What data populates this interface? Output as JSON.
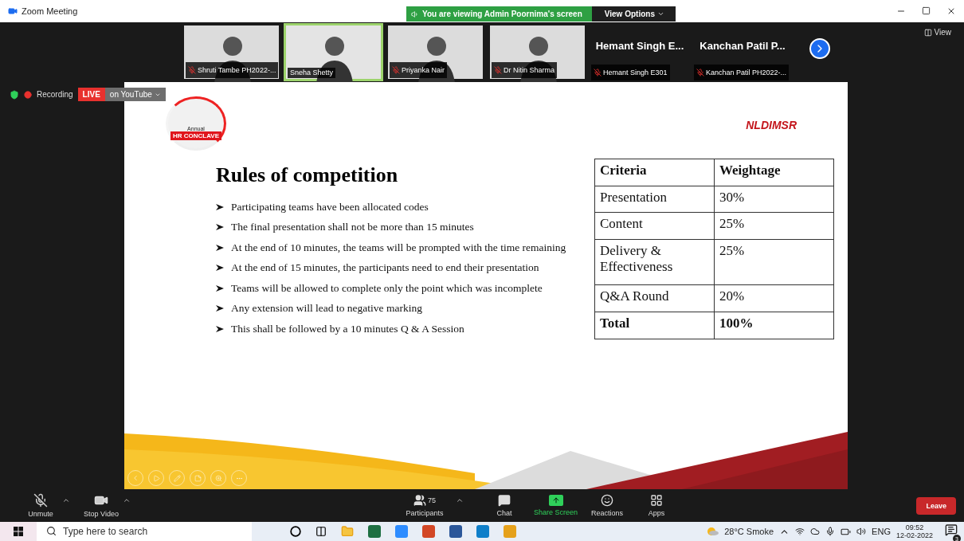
{
  "window": {
    "title": "Zoom Meeting"
  },
  "share_banner": {
    "text": "You are viewing Admin Poornima's screen",
    "options": "View Options"
  },
  "view_button": "View",
  "participants_strip": [
    {
      "kind": "video",
      "name": "Shruti Tambe PH2022-...",
      "muted": true,
      "speaking": false
    },
    {
      "kind": "video",
      "name": "Sneha Shetty",
      "muted": false,
      "speaking": true
    },
    {
      "kind": "video",
      "name": "Priyanka Nair",
      "muted": true,
      "speaking": false
    },
    {
      "kind": "video",
      "name": "Dr Nitin Sharma",
      "muted": true,
      "speaking": false
    },
    {
      "kind": "name",
      "title": "Hemant Singh E...",
      "name": "Hemant Singh E301",
      "muted": true
    },
    {
      "kind": "name",
      "title": "Kanchan Patil P...",
      "name": "Kanchan Patil PH2022-...",
      "muted": true
    }
  ],
  "recording": {
    "label": "Recording",
    "live": "LIVE",
    "stream": "on YouTube"
  },
  "slide": {
    "logo": {
      "line1": "Annual",
      "line2": "HR CONCLAVE"
    },
    "institute": "NLDIMSR",
    "title": "Rules of competition",
    "bullets": [
      "Participating teams have been allocated codes",
      "The final presentation shall not be more than 15 minutes",
      "At the end of 10 minutes, the teams will be prompted with the time remaining",
      "At the end of 15 minutes, the participants need to end their presentation",
      "Teams will be allowed to complete only the point which was incomplete",
      "Any extension will lead to negative marking",
      "This shall be followed by a 10 minutes Q & A Session"
    ],
    "table": {
      "columns": [
        "Criteria",
        "Weightage"
      ],
      "rows": [
        {
          "cells": [
            "Presentation",
            "30%"
          ],
          "bold": false
        },
        {
          "cells": [
            "Content",
            "25%"
          ],
          "bold": false
        },
        {
          "cells": [
            "Delivery & Effectiveness",
            "25%"
          ],
          "bold": false
        },
        {
          "cells": [
            "Q&A Round",
            "20%"
          ],
          "bold": false
        },
        {
          "cells": [
            "Total",
            "100%"
          ],
          "bold": true
        }
      ]
    }
  },
  "toolbar": {
    "left": [
      {
        "kind": "mic",
        "label": "Unmute",
        "muted": true
      },
      {
        "kind": "video",
        "label": "Stop Video",
        "muted": false
      }
    ],
    "center": [
      {
        "kind": "participants",
        "label": "Participants",
        "count": "75",
        "active": false
      },
      {
        "kind": "chat",
        "label": "Chat",
        "active": false
      },
      {
        "kind": "share",
        "label": "Share Screen",
        "active": true
      },
      {
        "kind": "reactions",
        "label": "Reactions",
        "active": false
      },
      {
        "kind": "apps",
        "label": "Apps",
        "active": false
      }
    ],
    "leave": "Leave"
  },
  "taskbar": {
    "search_placeholder": "Type here to search",
    "weather": "28°C Smoke",
    "language": "ENG",
    "time": "09:52",
    "date": "12-02-2022",
    "notifications": "3"
  }
}
